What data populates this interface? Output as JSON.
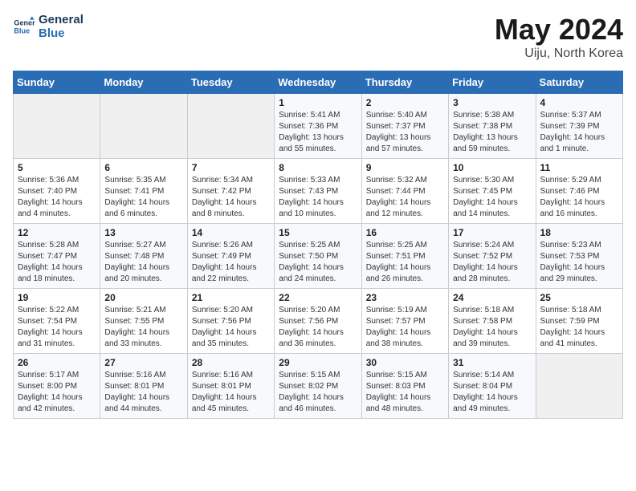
{
  "header": {
    "logo_line1": "General",
    "logo_line2": "Blue",
    "month": "May 2024",
    "location": "Uiju, North Korea"
  },
  "weekdays": [
    "Sunday",
    "Monday",
    "Tuesday",
    "Wednesday",
    "Thursday",
    "Friday",
    "Saturday"
  ],
  "weeks": [
    [
      {
        "day": "",
        "sunrise": "",
        "sunset": "",
        "daylight": ""
      },
      {
        "day": "",
        "sunrise": "",
        "sunset": "",
        "daylight": ""
      },
      {
        "day": "",
        "sunrise": "",
        "sunset": "",
        "daylight": ""
      },
      {
        "day": "1",
        "sunrise": "Sunrise: 5:41 AM",
        "sunset": "Sunset: 7:36 PM",
        "daylight": "Daylight: 13 hours and 55 minutes."
      },
      {
        "day": "2",
        "sunrise": "Sunrise: 5:40 AM",
        "sunset": "Sunset: 7:37 PM",
        "daylight": "Daylight: 13 hours and 57 minutes."
      },
      {
        "day": "3",
        "sunrise": "Sunrise: 5:38 AM",
        "sunset": "Sunset: 7:38 PM",
        "daylight": "Daylight: 13 hours and 59 minutes."
      },
      {
        "day": "4",
        "sunrise": "Sunrise: 5:37 AM",
        "sunset": "Sunset: 7:39 PM",
        "daylight": "Daylight: 14 hours and 1 minute."
      }
    ],
    [
      {
        "day": "5",
        "sunrise": "Sunrise: 5:36 AM",
        "sunset": "Sunset: 7:40 PM",
        "daylight": "Daylight: 14 hours and 4 minutes."
      },
      {
        "day": "6",
        "sunrise": "Sunrise: 5:35 AM",
        "sunset": "Sunset: 7:41 PM",
        "daylight": "Daylight: 14 hours and 6 minutes."
      },
      {
        "day": "7",
        "sunrise": "Sunrise: 5:34 AM",
        "sunset": "Sunset: 7:42 PM",
        "daylight": "Daylight: 14 hours and 8 minutes."
      },
      {
        "day": "8",
        "sunrise": "Sunrise: 5:33 AM",
        "sunset": "Sunset: 7:43 PM",
        "daylight": "Daylight: 14 hours and 10 minutes."
      },
      {
        "day": "9",
        "sunrise": "Sunrise: 5:32 AM",
        "sunset": "Sunset: 7:44 PM",
        "daylight": "Daylight: 14 hours and 12 minutes."
      },
      {
        "day": "10",
        "sunrise": "Sunrise: 5:30 AM",
        "sunset": "Sunset: 7:45 PM",
        "daylight": "Daylight: 14 hours and 14 minutes."
      },
      {
        "day": "11",
        "sunrise": "Sunrise: 5:29 AM",
        "sunset": "Sunset: 7:46 PM",
        "daylight": "Daylight: 14 hours and 16 minutes."
      }
    ],
    [
      {
        "day": "12",
        "sunrise": "Sunrise: 5:28 AM",
        "sunset": "Sunset: 7:47 PM",
        "daylight": "Daylight: 14 hours and 18 minutes."
      },
      {
        "day": "13",
        "sunrise": "Sunrise: 5:27 AM",
        "sunset": "Sunset: 7:48 PM",
        "daylight": "Daylight: 14 hours and 20 minutes."
      },
      {
        "day": "14",
        "sunrise": "Sunrise: 5:26 AM",
        "sunset": "Sunset: 7:49 PM",
        "daylight": "Daylight: 14 hours and 22 minutes."
      },
      {
        "day": "15",
        "sunrise": "Sunrise: 5:25 AM",
        "sunset": "Sunset: 7:50 PM",
        "daylight": "Daylight: 14 hours and 24 minutes."
      },
      {
        "day": "16",
        "sunrise": "Sunrise: 5:25 AM",
        "sunset": "Sunset: 7:51 PM",
        "daylight": "Daylight: 14 hours and 26 minutes."
      },
      {
        "day": "17",
        "sunrise": "Sunrise: 5:24 AM",
        "sunset": "Sunset: 7:52 PM",
        "daylight": "Daylight: 14 hours and 28 minutes."
      },
      {
        "day": "18",
        "sunrise": "Sunrise: 5:23 AM",
        "sunset": "Sunset: 7:53 PM",
        "daylight": "Daylight: 14 hours and 29 minutes."
      }
    ],
    [
      {
        "day": "19",
        "sunrise": "Sunrise: 5:22 AM",
        "sunset": "Sunset: 7:54 PM",
        "daylight": "Daylight: 14 hours and 31 minutes."
      },
      {
        "day": "20",
        "sunrise": "Sunrise: 5:21 AM",
        "sunset": "Sunset: 7:55 PM",
        "daylight": "Daylight: 14 hours and 33 minutes."
      },
      {
        "day": "21",
        "sunrise": "Sunrise: 5:20 AM",
        "sunset": "Sunset: 7:56 PM",
        "daylight": "Daylight: 14 hours and 35 minutes."
      },
      {
        "day": "22",
        "sunrise": "Sunrise: 5:20 AM",
        "sunset": "Sunset: 7:56 PM",
        "daylight": "Daylight: 14 hours and 36 minutes."
      },
      {
        "day": "23",
        "sunrise": "Sunrise: 5:19 AM",
        "sunset": "Sunset: 7:57 PM",
        "daylight": "Daylight: 14 hours and 38 minutes."
      },
      {
        "day": "24",
        "sunrise": "Sunrise: 5:18 AM",
        "sunset": "Sunset: 7:58 PM",
        "daylight": "Daylight: 14 hours and 39 minutes."
      },
      {
        "day": "25",
        "sunrise": "Sunrise: 5:18 AM",
        "sunset": "Sunset: 7:59 PM",
        "daylight": "Daylight: 14 hours and 41 minutes."
      }
    ],
    [
      {
        "day": "26",
        "sunrise": "Sunrise: 5:17 AM",
        "sunset": "Sunset: 8:00 PM",
        "daylight": "Daylight: 14 hours and 42 minutes."
      },
      {
        "day": "27",
        "sunrise": "Sunrise: 5:16 AM",
        "sunset": "Sunset: 8:01 PM",
        "daylight": "Daylight: 14 hours and 44 minutes."
      },
      {
        "day": "28",
        "sunrise": "Sunrise: 5:16 AM",
        "sunset": "Sunset: 8:01 PM",
        "daylight": "Daylight: 14 hours and 45 minutes."
      },
      {
        "day": "29",
        "sunrise": "Sunrise: 5:15 AM",
        "sunset": "Sunset: 8:02 PM",
        "daylight": "Daylight: 14 hours and 46 minutes."
      },
      {
        "day": "30",
        "sunrise": "Sunrise: 5:15 AM",
        "sunset": "Sunset: 8:03 PM",
        "daylight": "Daylight: 14 hours and 48 minutes."
      },
      {
        "day": "31",
        "sunrise": "Sunrise: 5:14 AM",
        "sunset": "Sunset: 8:04 PM",
        "daylight": "Daylight: 14 hours and 49 minutes."
      },
      {
        "day": "",
        "sunrise": "",
        "sunset": "",
        "daylight": ""
      }
    ]
  ]
}
